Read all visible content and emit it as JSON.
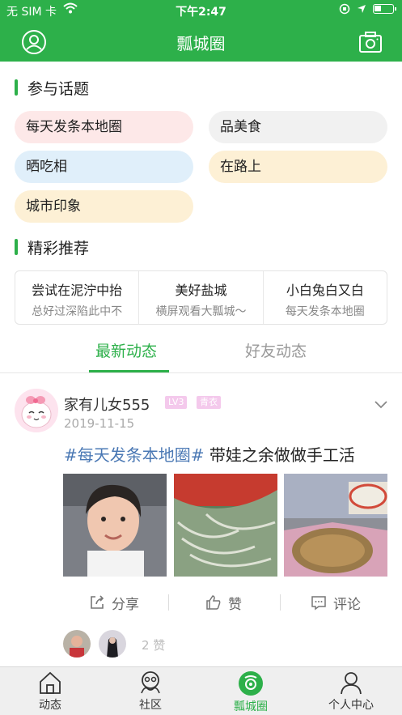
{
  "status": {
    "carrier": "无 SIM 卡",
    "time": "下午2:47"
  },
  "nav": {
    "title": "瓢城圈"
  },
  "topics": {
    "heading": "参与话题",
    "chips": [
      {
        "label": "每天发条本地圈",
        "color": "#fde8e8"
      },
      {
        "label": "品美食",
        "color": "#f1f1f1"
      },
      {
        "label": "晒吃相",
        "color": "#e0effa"
      },
      {
        "label": "在路上",
        "color": "#fdf0d5"
      },
      {
        "label": "城市印象",
        "color": "#fdf0d5"
      }
    ]
  },
  "recommend": {
    "heading": "精彩推荐",
    "items": [
      {
        "title": "尝试在泥泞中抬",
        "subtitle": "总好过深陷此中不"
      },
      {
        "title": "美好盐城",
        "subtitle": "横屏观看大瓢城～"
      },
      {
        "title": "小白兔白又白",
        "subtitle": "每天发条本地圈"
      }
    ]
  },
  "feed_tabs": {
    "active": "最新动态",
    "inactive": "好友动态"
  },
  "post": {
    "username": "家有儿女555",
    "level": "LV3",
    "role": "青衣",
    "date": "2019-11-15",
    "hashtag": "#每天发条本地圈#",
    "text": " 带娃之余做做手工活",
    "actions": {
      "share": "分享",
      "like": "赞",
      "comment": "评论"
    },
    "like_count": "2 赞"
  },
  "tabbar": {
    "items": [
      {
        "label": "动态",
        "icon": "home-icon"
      },
      {
        "label": "社区",
        "icon": "community-icon"
      },
      {
        "label": "瓢城圈",
        "icon": "circle-camera-icon"
      },
      {
        "label": "个人中心",
        "icon": "person-icon"
      }
    ],
    "active_index": 2
  },
  "colors": {
    "brand": "#2db04a",
    "link": "#4a78b4"
  }
}
